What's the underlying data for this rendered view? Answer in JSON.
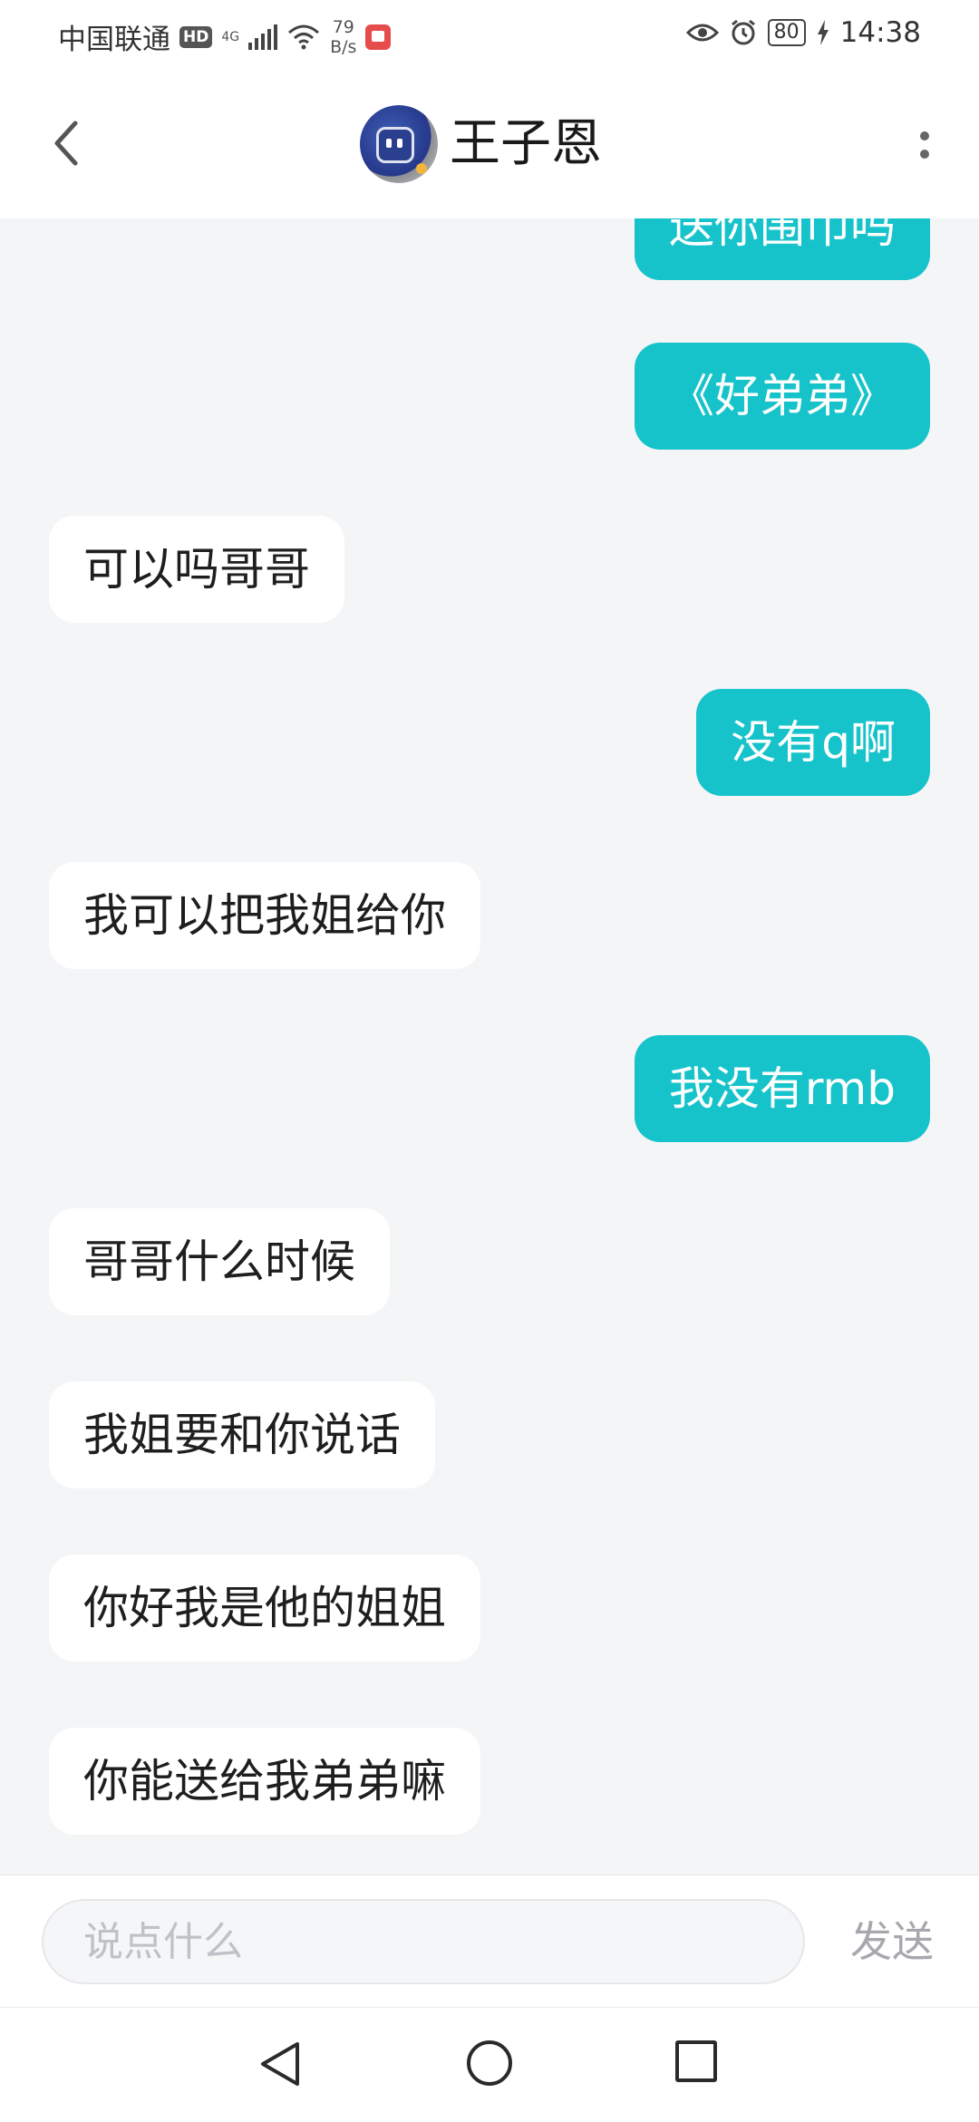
{
  "status_bar": {
    "carrier": "中国联通",
    "hd": "HD",
    "network_type": "4G",
    "speed_value": "79",
    "speed_unit": "B/s",
    "battery": "80",
    "time": "14:38"
  },
  "header": {
    "contact_name": "王子恩"
  },
  "messages": [
    {
      "side": "sent",
      "text": "送你围巾吗"
    },
    {
      "side": "sent",
      "text": "《好弟弟》"
    },
    {
      "side": "received",
      "text": "可以吗哥哥"
    },
    {
      "side": "sent",
      "text": "没有q啊"
    },
    {
      "side": "received",
      "text": "我可以把我姐给你"
    },
    {
      "side": "sent",
      "text": "我没有rmb"
    },
    {
      "side": "received",
      "text": "哥哥什么时候"
    },
    {
      "side": "received",
      "text": "我姐要和你说话"
    },
    {
      "side": "received",
      "text": "你好我是他的姐姐"
    },
    {
      "side": "received",
      "text": "你能送给我弟弟嘛"
    }
  ],
  "composer": {
    "placeholder": "说点什么",
    "send_label": "发送"
  },
  "colors": {
    "sent_bubble": "#17c3cb",
    "received_bubble": "#ffffff",
    "background": "#f4f5f7"
  }
}
